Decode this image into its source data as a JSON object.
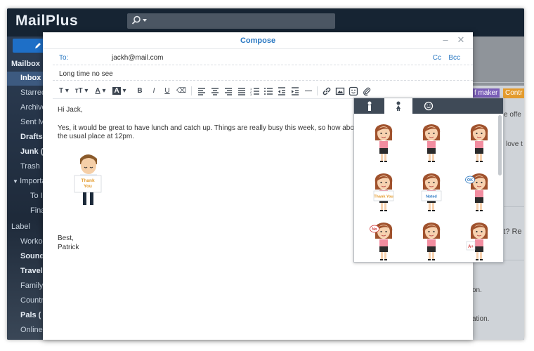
{
  "app": {
    "name": "MailPlus"
  },
  "sidebar": {
    "items": [
      {
        "label": "Mailbox"
      },
      {
        "label": "Inbox"
      },
      {
        "label": "Starred"
      },
      {
        "label": "Archive"
      },
      {
        "label": "Sent M"
      },
      {
        "label": "Drafts"
      },
      {
        "label": "Junk ("
      },
      {
        "label": "Trash"
      },
      {
        "label": "Importa"
      },
      {
        "label": "To I"
      },
      {
        "label": "Fina"
      },
      {
        "label": "Label"
      },
      {
        "label": "Worko"
      },
      {
        "label": "Sound"
      },
      {
        "label": "Travel"
      },
      {
        "label": "Family"
      },
      {
        "label": "Countr"
      },
      {
        "label": "Pals ("
      },
      {
        "label": "Online"
      }
    ]
  },
  "right_pane": {
    "tags": [
      "f maker",
      "Contr"
    ],
    "snippets": [
      "ve offe",
      "love t",
      "ght? Re",
      "on.",
      "ation."
    ]
  },
  "compose": {
    "title": "Compose",
    "to_label": "To:",
    "to_value": "jackh@mail.com",
    "cc_label": "Cc",
    "bcc_label": "Bcc",
    "subject": "Long time no see",
    "body": {
      "greeting": "Hi Jack,",
      "line1": "Yes, it would be great to have lunch and catch up. Things are really busy this week, so how about the N",
      "line2": "the usual place at 12pm.",
      "sticker_text": "Thank You",
      "closing": "Best,",
      "signature": "Patrick"
    }
  },
  "sticker_panel": {
    "stickers": [
      {
        "label": ""
      },
      {
        "label": ""
      },
      {
        "label": ""
      },
      {
        "label": "Thank You"
      },
      {
        "label": "Noted"
      },
      {
        "label": "OK"
      },
      {
        "label": "No"
      },
      {
        "label": ""
      },
      {
        "label": "A+"
      }
    ]
  },
  "colors": {
    "accent": "#2a78c2",
    "topbar": "#162433",
    "sidebar": "#2d3e55",
    "tag_purple": "#7b5fb8",
    "tag_orange": "#e39b2d"
  }
}
